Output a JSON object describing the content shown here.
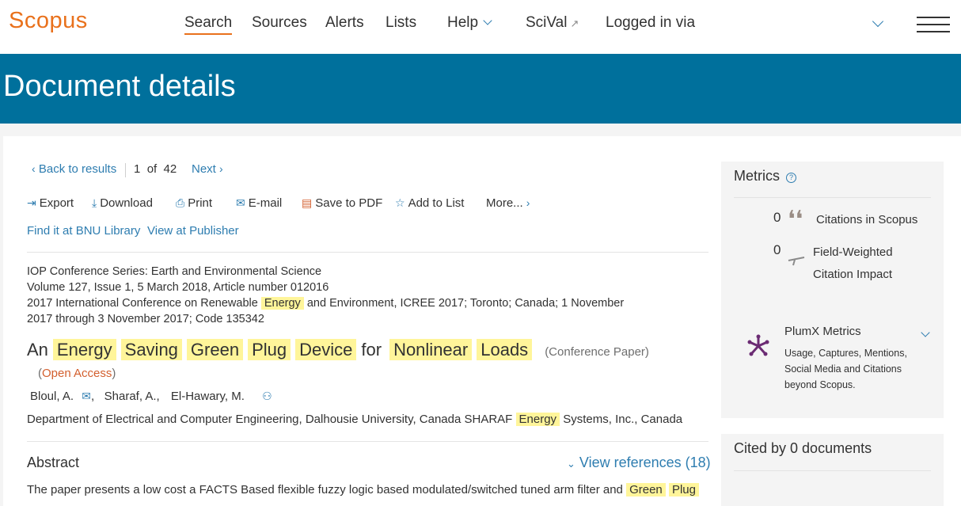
{
  "header": {
    "logo": "Scopus",
    "nav": {
      "search": "Search",
      "sources": "Sources",
      "alerts": "Alerts",
      "lists": "Lists",
      "help": "Help",
      "scival": "SciVal",
      "scival_arrow": "↗",
      "logged_in": "Logged in via"
    }
  },
  "banner": {
    "title": "Document details"
  },
  "navigation": {
    "back": "Back to results",
    "position": "1",
    "of": "of",
    "total": "42",
    "next": "Next"
  },
  "toolbar": {
    "export": "Export",
    "download": "Download",
    "print": "Print",
    "email": "E-mail",
    "save_pdf": "Save to PDF",
    "add_list": "Add to List",
    "more": "More..."
  },
  "links": {
    "find_it": "Find it at BNU Library",
    "view_publisher": "View at Publisher"
  },
  "source": {
    "series": "IOP Conference Series: Earth and Environmental Science",
    "volume": "Volume 127, Issue 1, 5 March 2018, Article number 012016",
    "conf_a": "2017 International Conference on Renewable",
    "conf_hl": "Energy",
    "conf_b": "and Environment, ICREE 2017; Toronto; Canada; 1 November",
    "conf_c": "2017 through 3 November 2017; Code 135342"
  },
  "document": {
    "title_words": [
      {
        "text": "An",
        "hl": false
      },
      {
        "text": "Energy",
        "hl": true
      },
      {
        "text": "Saving",
        "hl": true
      },
      {
        "text": "Green",
        "hl": true
      },
      {
        "text": "Plug",
        "hl": true
      },
      {
        "text": "Device",
        "hl": true
      },
      {
        "text": "for",
        "hl": false
      },
      {
        "text": "Nonlinear",
        "hl": true
      },
      {
        "text": "Loads",
        "hl": true
      }
    ],
    "type": "(Conference Paper)",
    "open_access_open": "(",
    "open_access": "Open Access",
    "open_access_close": ")",
    "authors": [
      "Bloul, A.",
      "Sharaf, A.,",
      "El-Hawary, M."
    ],
    "affil_a": "Department of Electrical and Computer Engineering, Dalhousie University, Canada SHARAF",
    "affil_hl": "Energy",
    "affil_b": "Systems, Inc., Canada"
  },
  "abstract": {
    "heading": "Abstract",
    "view_refs": "View references (18)",
    "line1_a": "The paper presents a low cost a FACTS Based flexible fuzzy logic based modulated/switched tuned arm filter and",
    "line1_hl1": "Green",
    "line1_hl2": "Plug"
  },
  "metrics": {
    "title": "Metrics",
    "citations_value": "0",
    "citations_label": "Citations in Scopus",
    "fwci_value": "0",
    "fwci_label_1": "Field-Weighted",
    "fwci_label_2": "Citation Impact",
    "plumx_title": "PlumX Metrics",
    "plumx_desc_1": "Usage, Captures, Mentions,",
    "plumx_desc_2": "Social Media and Citations",
    "plumx_desc_3": "beyond Scopus."
  },
  "cited_by": {
    "title": "Cited by 0 documents"
  },
  "colors": {
    "brand_orange": "#e9711c",
    "banner_blue": "#00709c",
    "link_blue": "#2e7db0",
    "highlight": "#fff59a"
  }
}
